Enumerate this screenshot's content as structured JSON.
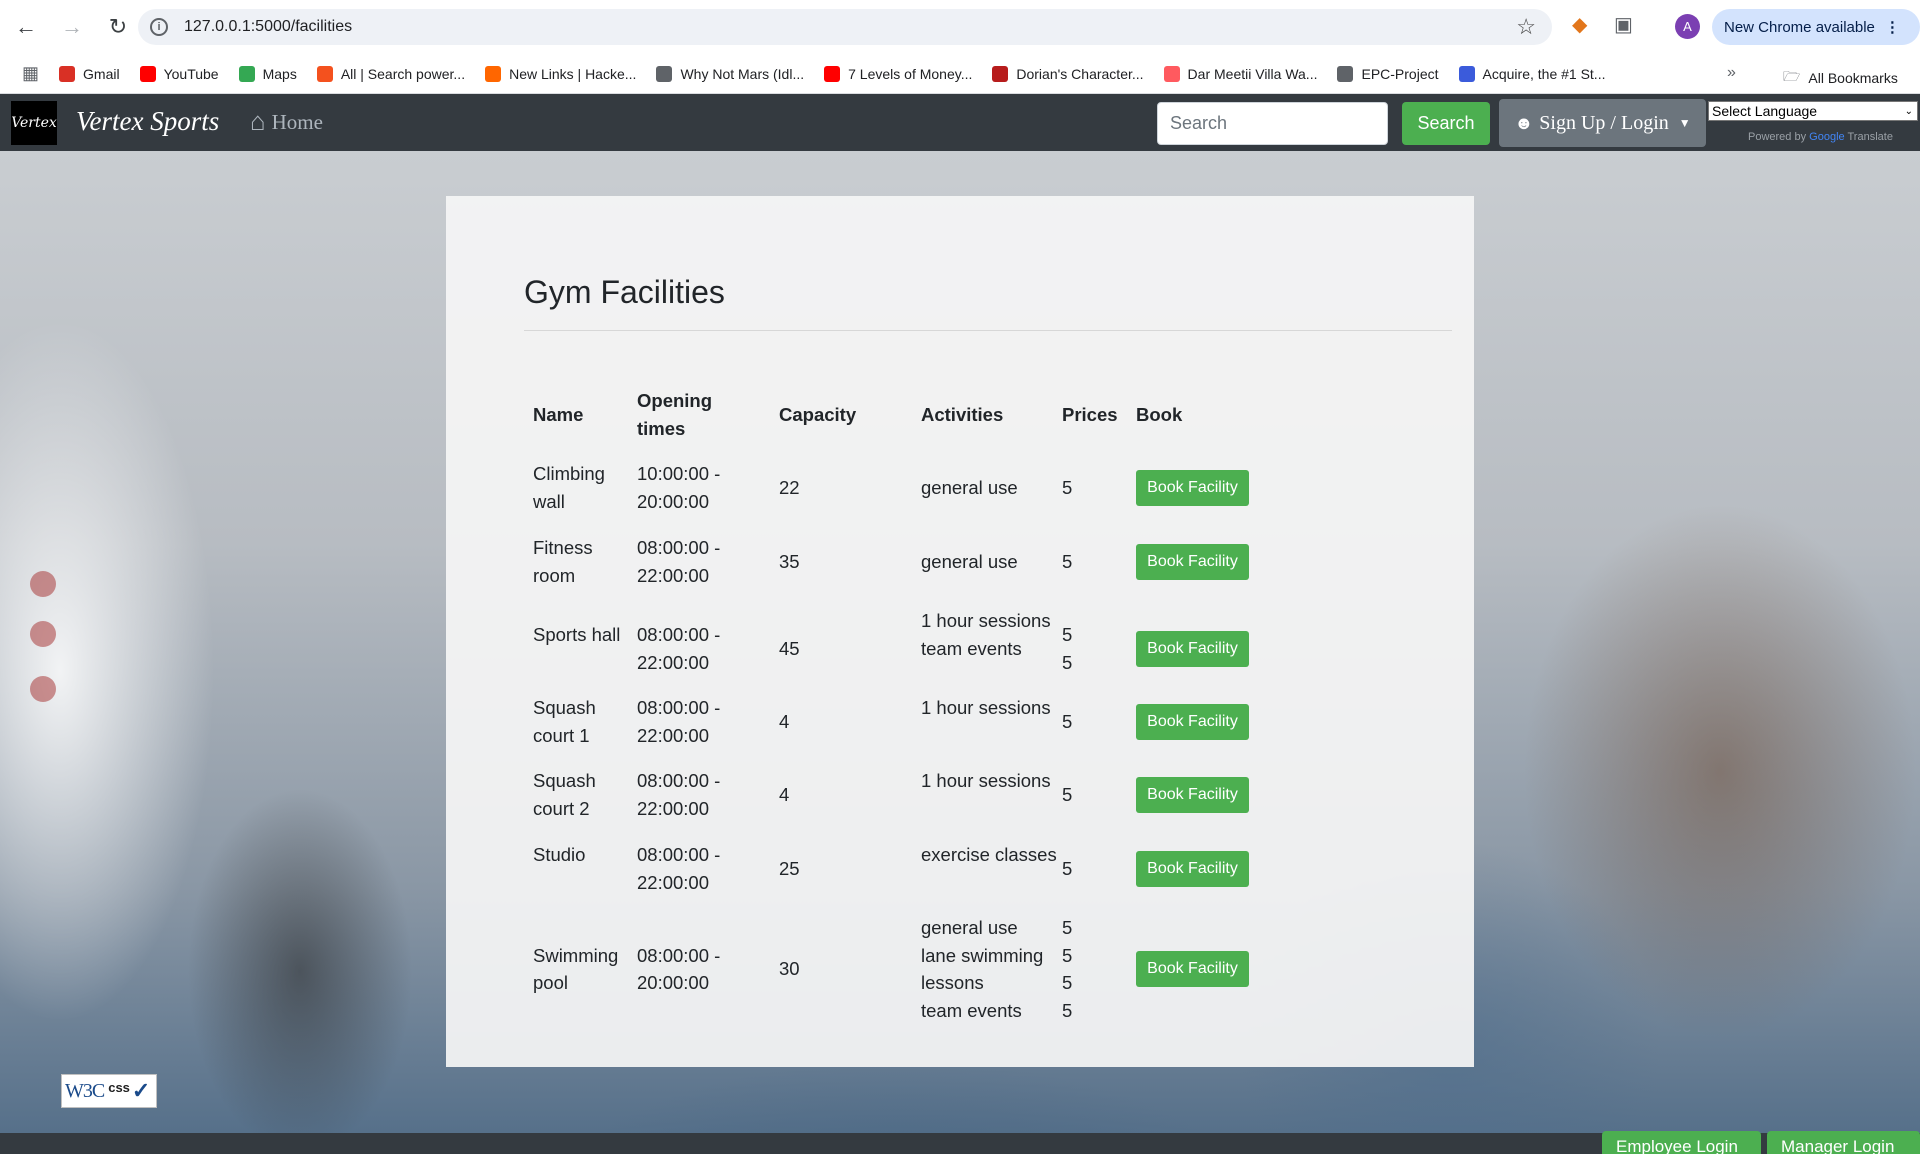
{
  "browser": {
    "url": "127.0.0.1:5000/facilities",
    "new_chrome_label": "New Chrome available",
    "avatar_letter": "A",
    "bookmarks": [
      {
        "label": "Gmail",
        "color": "#d93025",
        "icon": "gmail-icon"
      },
      {
        "label": "YouTube",
        "color": "#ff0000",
        "icon": "youtube-icon"
      },
      {
        "label": "Maps",
        "color": "#34a853",
        "icon": "maps-icon"
      },
      {
        "label": "All | Search power...",
        "color": "#f4511e",
        "icon": "search-power-icon"
      },
      {
        "label": "New Links | Hacke...",
        "color": "#ff6600",
        "icon": "hacker-news-icon"
      },
      {
        "label": "Why Not Mars (Idl...",
        "color": "#5f6368",
        "icon": "globe-icon"
      },
      {
        "label": "7 Levels of Money...",
        "color": "#ff0000",
        "icon": "youtube-icon"
      },
      {
        "label": "Dorian's Character...",
        "color": "#b71c1c",
        "icon": "dnd-icon"
      },
      {
        "label": "Dar Meetii Villa Wa...",
        "color": "#ff5a5f",
        "icon": "airbnb-icon"
      },
      {
        "label": "EPC-Project",
        "color": "#5f6368",
        "icon": "folder-icon"
      },
      {
        "label": "Acquire, the #1 St...",
        "color": "#3b5bdb",
        "icon": "acquire-icon"
      }
    ],
    "all_bookmarks_label": "All Bookmarks"
  },
  "nav": {
    "logo_text": "Vertex",
    "brand": "Vertex Sports",
    "home_label": "Home",
    "search_placeholder": "Search",
    "search_button": "Search",
    "signup_label": "Sign Up / Login",
    "language_select": "Select Language",
    "powered_by": "Powered by",
    "google": "Google",
    "translate": "Translate"
  },
  "page": {
    "title": "Gym Facilities",
    "columns": [
      "Name",
      "Opening times",
      "Capacity",
      "Activities",
      "Prices",
      "Book"
    ],
    "book_label": "Book Facility",
    "facilities": [
      {
        "name": "Climbing wall",
        "open": "10:00:00 - 20:00:00",
        "capacity": "22",
        "activities": [
          "general use"
        ],
        "prices": [
          "5"
        ]
      },
      {
        "name": "Fitness room",
        "open": "08:00:00 - 22:00:00",
        "capacity": "35",
        "activities": [
          "general use"
        ],
        "prices": [
          "5"
        ]
      },
      {
        "name": "Sports hall",
        "open": "08:00:00 - 22:00:00",
        "capacity": "45",
        "activities": [
          "1 hour sessions",
          "team events"
        ],
        "prices": [
          "5",
          "5"
        ]
      },
      {
        "name": "Squash court 1",
        "open": "08:00:00 - 22:00:00",
        "capacity": "4",
        "activities": [
          "1 hour sessions"
        ],
        "prices": [
          "5"
        ]
      },
      {
        "name": "Squash court 2",
        "open": "08:00:00 - 22:00:00",
        "capacity": "4",
        "activities": [
          "1 hour sessions"
        ],
        "prices": [
          "5"
        ]
      },
      {
        "name": "Studio",
        "open": "08:00:00 - 22:00:00",
        "capacity": "25",
        "activities": [
          "exercise classes"
        ],
        "prices": [
          "5"
        ]
      },
      {
        "name": "Swimming pool",
        "open": "08:00:00 - 20:00:00",
        "capacity": "30",
        "activities": [
          "general use",
          "lane swimming",
          "lessons",
          "team events"
        ],
        "prices": [
          "5",
          "5",
          "5",
          "5"
        ]
      }
    ]
  },
  "footer": {
    "w3c_text": "W3C",
    "css_text": "css",
    "employee_login": "Employee Login",
    "manager_login": "Manager Login"
  },
  "colors": {
    "navbar": "#343a40",
    "accent_green": "#4caf50",
    "signup_grey": "#6c757d"
  }
}
